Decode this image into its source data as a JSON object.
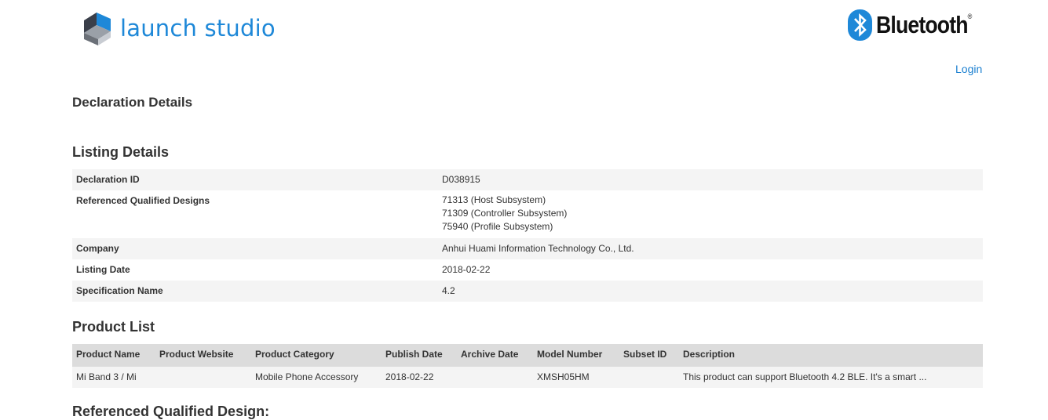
{
  "header": {
    "logo_text": "launch studio",
    "brand_text": "Bluetooth",
    "brand_mark": "®",
    "login_label": "Login"
  },
  "page": {
    "title": "Declaration Details",
    "listing_heading": "Listing Details",
    "product_heading": "Product List",
    "ref_heading": "Referenced Qualified Design:"
  },
  "listing": [
    {
      "key": "Declaration ID",
      "values": [
        "D038915"
      ]
    },
    {
      "key": "Referenced Qualified Designs",
      "values": [
        "71313 (Host Subsystem)",
        "71309 (Controller Subsystem)",
        "75940 (Profile Subsystem)"
      ]
    },
    {
      "key": "Company",
      "values": [
        "Anhui Huami Information Technology Co., Ltd."
      ]
    },
    {
      "key": "Listing Date",
      "values": [
        "2018-02-22"
      ]
    },
    {
      "key": "Specification Name",
      "values": [
        "4.2"
      ]
    }
  ],
  "product_table": {
    "headers": [
      "Product Name",
      "Product Website",
      "Product Category",
      "Publish Date",
      "Archive Date",
      "Model Number",
      "Subset ID",
      "Description"
    ],
    "rows": [
      [
        "Mi Band 3 / Mi",
        "",
        "Mobile Phone Accessory",
        "2018-02-22",
        "",
        "XMSH05HM",
        "",
        "This product can support Bluetooth 4.2 BLE. It's a smart ..."
      ]
    ]
  },
  "icons": {
    "logo": "launch-studio-cube-icon",
    "brand": "bluetooth-rune-icon"
  },
  "colors": {
    "link": "#1a7fd0",
    "logo_blue": "#1e88d8",
    "row_alt": "#f4f4f4",
    "header_bg": "#dcdcdc"
  }
}
